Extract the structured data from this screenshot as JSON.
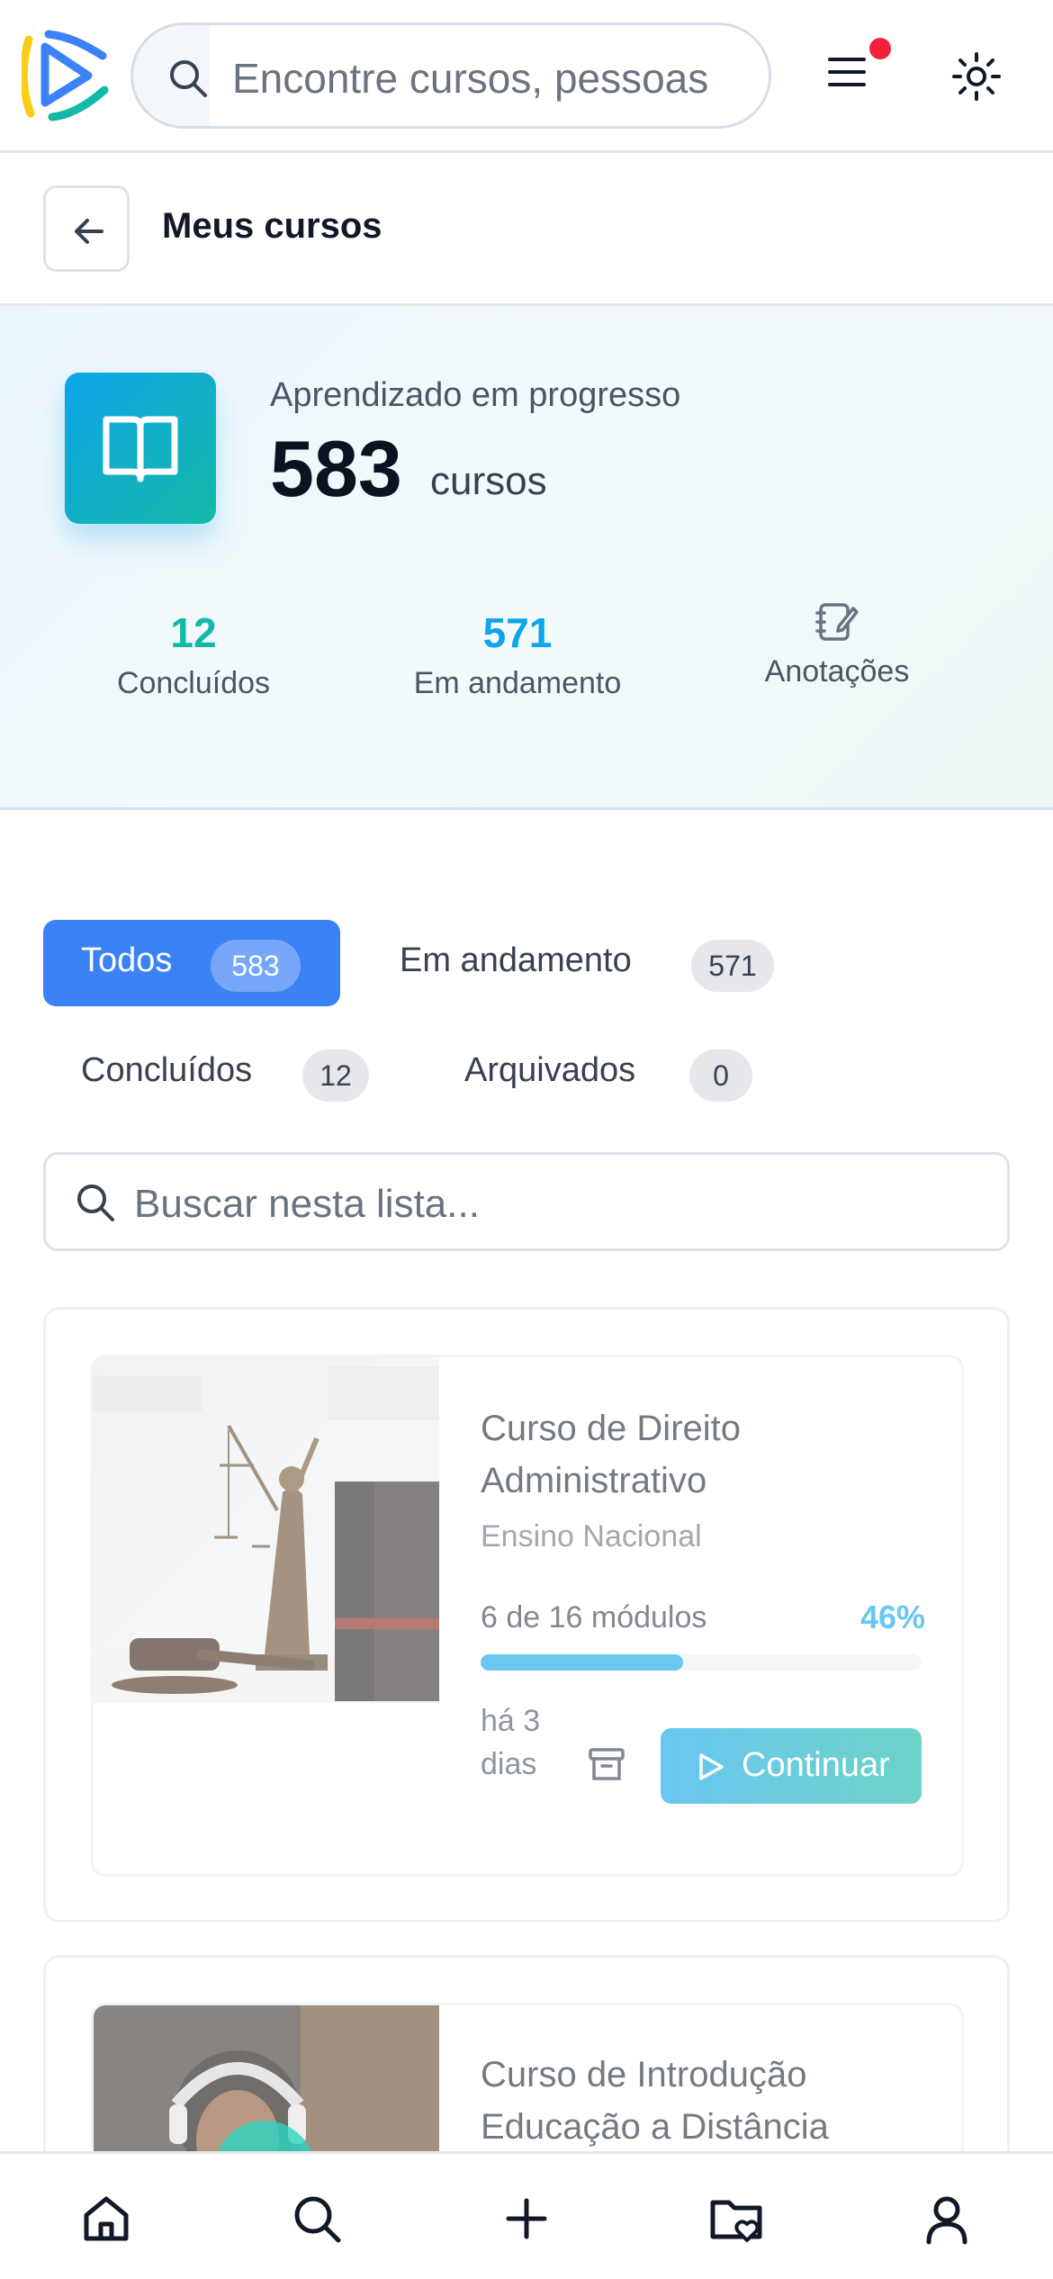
{
  "header": {
    "search_placeholder": "Encontre cursos, pessoas",
    "icons": [
      "logo",
      "search-icon",
      "menu-icon",
      "theme-sun-icon"
    ]
  },
  "page": {
    "title": "Meus cursos"
  },
  "summary": {
    "label": "Aprendizado em progresso",
    "count": "583",
    "unit": "cursos",
    "stats": [
      {
        "value": "12",
        "label": "Concluídos",
        "color": "#14b8a6"
      },
      {
        "value": "571",
        "label": "Em andamento",
        "color": "#0ea5e9"
      },
      {
        "label": "Anotações",
        "icon": "notes-icon"
      }
    ]
  },
  "tabs": [
    {
      "label": "Todos",
      "count": "583",
      "active": true
    },
    {
      "label": "Em andamento",
      "count": "571",
      "active": false
    },
    {
      "label": "Concluídos",
      "count": "12",
      "active": false
    },
    {
      "label": "Arquivados",
      "count": "0",
      "active": false
    }
  ],
  "list_search": {
    "placeholder": "Buscar nesta lista..."
  },
  "courses": [
    {
      "title": "Curso de Direito Administrativo",
      "provider": "Ensino Nacional",
      "modules": "6 de 16 módulos",
      "percent": "46%",
      "progress": 0.46,
      "updated": "há 3 dias",
      "action": "Continuar"
    },
    {
      "title": "Curso de Introdução Educação a Distância"
    }
  ],
  "bottom_nav": [
    "home-icon",
    "search-icon",
    "plus-icon",
    "favorites-folder-icon",
    "profile-icon"
  ],
  "colors": {
    "accent": "#3b82f6",
    "brand_blue": "#0ea5e9",
    "brand_teal": "#14b8a6",
    "notification": "#ef233c"
  }
}
